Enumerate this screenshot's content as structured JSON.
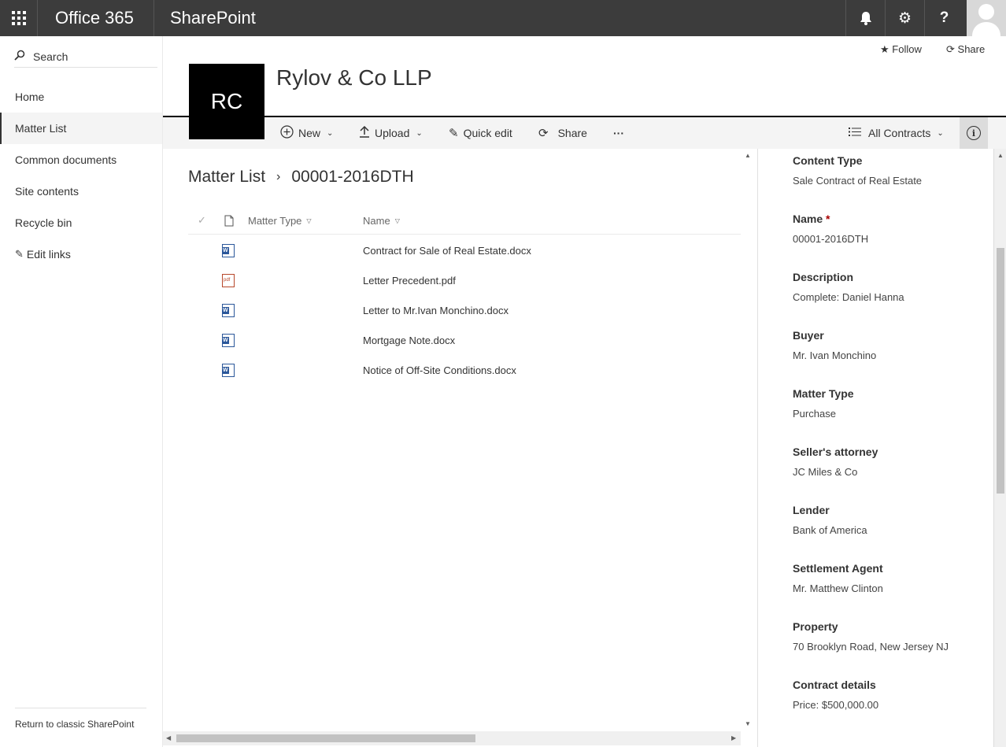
{
  "suitebar": {
    "brand": "Office 365",
    "app": "SharePoint",
    "icons": [
      "waffle-icon",
      "bell-icon",
      "gear-icon",
      "help-icon",
      "avatar"
    ]
  },
  "leftnav": {
    "search_label": "Search",
    "items": [
      {
        "label": "Home",
        "active": false
      },
      {
        "label": "Matter List",
        "active": true
      },
      {
        "label": "Common documents",
        "active": false
      },
      {
        "label": "Site contents",
        "active": false
      },
      {
        "label": "Recycle bin",
        "active": false
      },
      {
        "label": "Edit links",
        "active": false
      }
    ],
    "return_label": "Return to classic SharePoint"
  },
  "header": {
    "follow": "Follow",
    "share": "Share",
    "logo_text": "RC",
    "site_title": "Rylov & Co LLP"
  },
  "commandbar": {
    "new": "New",
    "upload": "Upload",
    "quick_edit": "Quick edit",
    "share": "Share",
    "more": "···",
    "view": "All Contracts"
  },
  "breadcrumb": {
    "root": "Matter List",
    "current": "00001-2016DTH"
  },
  "list": {
    "columns": {
      "matter_type": "Matter Type",
      "name": "Name"
    },
    "rows": [
      {
        "type": "word",
        "name": "Contract for Sale of Real Estate.docx"
      },
      {
        "type": "pdf",
        "name": "Letter Precedent.pdf"
      },
      {
        "type": "word",
        "name": "Letter to Mr.Ivan Monchino.docx"
      },
      {
        "type": "word",
        "name": "Mortgage Note.docx"
      },
      {
        "type": "word",
        "name": "Notice of Off-Site Conditions.docx"
      }
    ]
  },
  "panel": {
    "fields": [
      {
        "label": "Content Type",
        "value": "Sale Contract of Real Estate",
        "required": false
      },
      {
        "label": "Name",
        "value": "00001-2016DTH",
        "required": true
      },
      {
        "label": "Description",
        "value": "Complete: Daniel Hanna",
        "required": false
      },
      {
        "label": "Buyer",
        "value": "Mr. Ivan Monchino",
        "required": false
      },
      {
        "label": "Matter Type",
        "value": "Purchase",
        "required": false
      },
      {
        "label": "Seller's attorney",
        "value": "JC Miles & Co",
        "required": false
      },
      {
        "label": "Lender",
        "value": "Bank of America",
        "required": false
      },
      {
        "label": "Settlement Agent",
        "value": "Mr. Matthew Clinton",
        "required": false
      },
      {
        "label": "Property",
        "value": "70 Brooklyn Road, New Jersey NJ",
        "required": false
      },
      {
        "label": "Contract details",
        "value": "Price: $500,000.00",
        "required": false
      }
    ],
    "required_mark": "*"
  }
}
